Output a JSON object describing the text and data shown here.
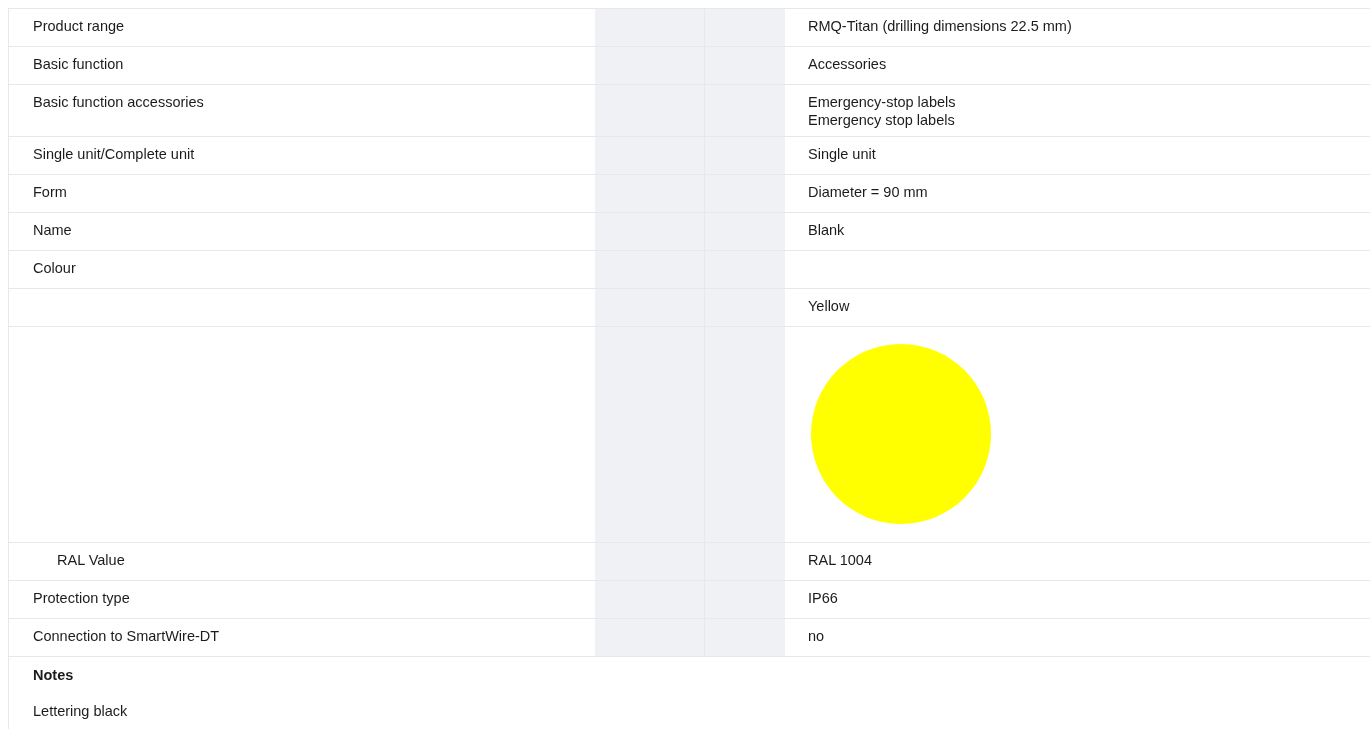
{
  "rows": [
    {
      "kind": "text",
      "label": "Product range",
      "value": "RMQ-Titan (drilling dimensions 22.5 mm)"
    },
    {
      "kind": "text",
      "label": "Basic function",
      "value": "Accessories"
    },
    {
      "kind": "lines",
      "label": "Basic function accessories",
      "values": [
        "Emergency-stop labels",
        "Emergency stop labels"
      ]
    },
    {
      "kind": "text",
      "label": "Single unit/Complete unit",
      "value": "Single unit"
    },
    {
      "kind": "text",
      "label": "Form",
      "value": "Diameter = 90 mm"
    },
    {
      "kind": "text",
      "label": "Name",
      "value": "Blank"
    },
    {
      "kind": "text",
      "label": "Colour",
      "children": [
        {
          "kind": "text",
          "value": "Yellow"
        },
        {
          "kind": "swatch",
          "color": "#ffff00"
        },
        {
          "kind": "text",
          "label": "RAL Value",
          "value": "RAL 1004"
        }
      ]
    },
    {
      "kind": "text",
      "label": "Protection type",
      "value": "IP66"
    },
    {
      "kind": "text",
      "label": "Connection to SmartWire-DT",
      "value": "no"
    }
  ],
  "notes": {
    "heading": "Notes",
    "items": [
      "Lettering black"
    ]
  }
}
